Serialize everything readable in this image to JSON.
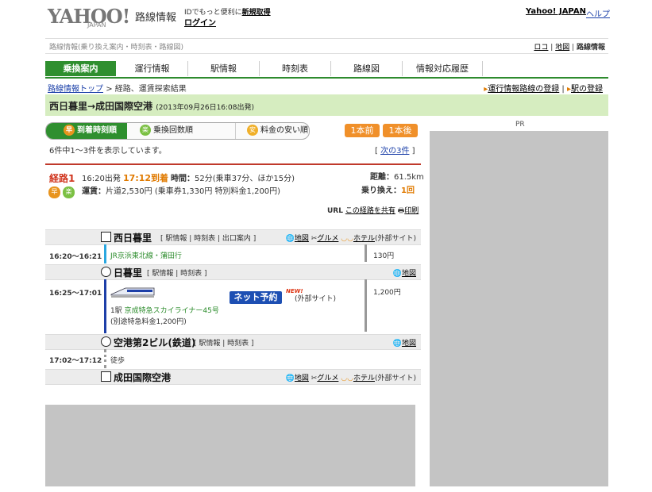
{
  "header": {
    "logo_main": "YAHOO!",
    "logo_sub": "JAPAN",
    "product": "路線情報",
    "id_text": "IDでもっと便利に",
    "id_register": "新規取得",
    "login": "ログイン",
    "yahoo_japan": "Yahoo! JAPAN",
    "help": "ヘルプ",
    "subtitle": "路線情報(乗り換え案内・時刻表・路線図)",
    "sub_links": [
      "ロコ",
      "地図",
      "路線情報"
    ]
  },
  "tabs": [
    "乗換案内",
    "運行情報",
    "駅情報",
    "時刻表",
    "路線図",
    "情報対応履歴"
  ],
  "breadcrumb": {
    "top": "路線情報トップ",
    "sep": ">",
    "current": "経路、運賃探索結果"
  },
  "crumb_right": [
    "運行情報路線の登録",
    "駅の登録"
  ],
  "title": {
    "route": "西日暮里→成田国際空港",
    "date": "(2013年09月26日16:08出発)"
  },
  "sort": [
    {
      "icon": "早",
      "label": "到着時刻順"
    },
    {
      "icon": "楽",
      "label": "乗換回数順"
    },
    {
      "icon": "安",
      "label": "料金の安い順"
    }
  ],
  "nav": {
    "prev": "1本前",
    "next": "1本後"
  },
  "result": {
    "count": "6件中1～3件を表示しています。",
    "next": "次の3件"
  },
  "pr": "PR",
  "route": {
    "label": "経路1",
    "badges": [
      "早",
      "楽"
    ],
    "depart": "16:20出発",
    "arrive": "17:12到着",
    "duration_label": "時間：",
    "duration": "52分(乗車37分、ほか15分)",
    "fare_label": "運賃：",
    "fare": "片道2,530円",
    "fare_detail": "(乗車券1,330円 特別料金1,200円)",
    "distance_label": "距離：",
    "distance": "61.5km",
    "transfer_label": "乗り換え：",
    "transfer": "1回",
    "share_prefix": "URL",
    "share": "この経路を共有",
    "print": "印刷"
  },
  "stations": [
    {
      "name": "西日暮里",
      "links": "[ 駅情報 | 時刻表 | 出口案内 ]",
      "map": "地図",
      "gourmet": "グルメ",
      "hotel": "ホテル",
      "ext": "(外部サイト)"
    },
    {
      "name": "日暮里",
      "links": "[ 駅情報 | 時刻表 ]",
      "map": "地図"
    },
    {
      "name": "空港第2ビル(鉄道)",
      "links": "[ 駅情報 | 時刻表 ]",
      "map": "地図"
    },
    {
      "name": "成田国際空港",
      "map": "地図",
      "gourmet": "グルメ",
      "hotel": "ホテル",
      "ext": "(外部サイト)"
    }
  ],
  "segments": [
    {
      "time": "16:20～16:21",
      "line": "JR京浜東北線・蒲田行",
      "fare": "130円"
    },
    {
      "time": "16:25～17:01",
      "stops": "1駅",
      "line": "京成特急スカイライナー45号",
      "extra": "(別途特急料金1,200円)",
      "fare": "1,200円",
      "reserve": "ネット予約",
      "new": "NEW!",
      "ext": "(外部サイト)"
    },
    {
      "time": "17:02～17:12",
      "line": "徒歩"
    }
  ],
  "colors": {
    "green": "#2f8f2f",
    "orange": "#f0902a",
    "red": "#d0341d",
    "link": "#1a3fa8"
  }
}
